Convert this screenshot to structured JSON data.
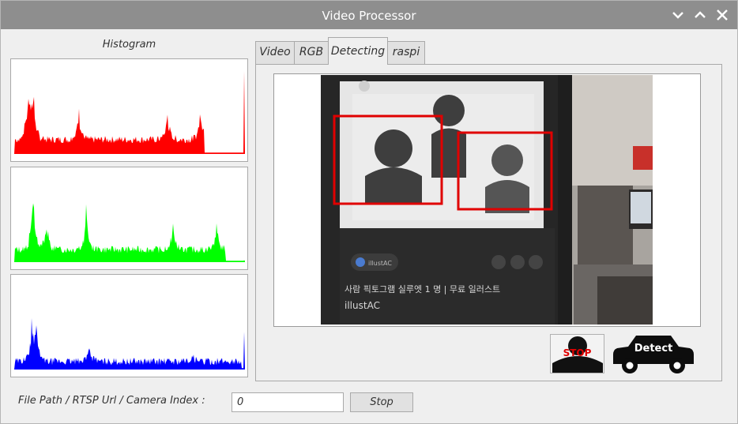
{
  "window": {
    "title": "Video Processor"
  },
  "histogram": {
    "label": "Histogram",
    "channels": [
      {
        "name": "red",
        "color": "#ff0000"
      },
      {
        "name": "green",
        "color": "#00ff00"
      },
      {
        "name": "blue",
        "color": "#0000ff"
      }
    ]
  },
  "tabs": [
    {
      "label": "Video",
      "active": false
    },
    {
      "label": "RGB",
      "active": false
    },
    {
      "label": "Detecting",
      "active": true
    },
    {
      "label": "raspi",
      "active": false
    }
  ],
  "video": {
    "detection_box_color": "#e00000",
    "overlay_text_line1": "사람 픽토그램 실루엣 1 명 | 무료 일러스트",
    "overlay_text_line2": "illustAC",
    "overlay_badge": "illustAC"
  },
  "controls": {
    "stop_icon_label": "STOP",
    "detect_label": "Detect"
  },
  "source": {
    "label": "File Path / RTSP Url / Camera Index :",
    "value": "0",
    "action_label": "Stop"
  }
}
